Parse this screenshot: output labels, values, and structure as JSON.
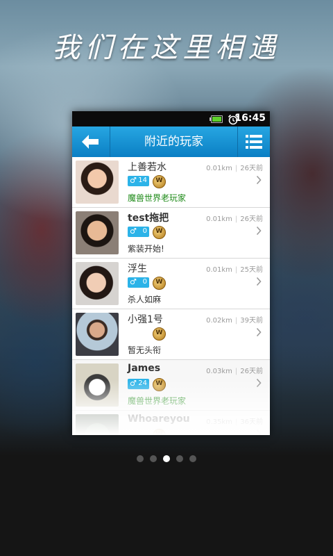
{
  "slogan": "我们在这里相遇",
  "status_bar": {
    "time": "16:45"
  },
  "header": {
    "title": "附近的玩家"
  },
  "players": [
    {
      "name": "上善若水",
      "age": "14",
      "distance": "0.01km",
      "time_ago": "26天前",
      "signature": "魔兽世界老玩家",
      "signature_color": "#1e8a18"
    },
    {
      "name": "test拖把",
      "age": "0",
      "distance": "0.01km",
      "time_ago": "26天前",
      "signature": "紫装开始!",
      "signature_color": "#333333"
    },
    {
      "name": "浮生",
      "age": "0",
      "distance": "0.01km",
      "time_ago": "25天前",
      "signature": "杀人如麻",
      "signature_color": "#333333"
    },
    {
      "name": "小强1号",
      "age": "",
      "distance": "0.02km",
      "time_ago": "39天前",
      "signature": "暂无头衔",
      "signature_color": "#333333"
    },
    {
      "name": "James",
      "age": "24",
      "distance": "0.03km",
      "time_ago": "26天前",
      "signature": "魔兽世界老玩家",
      "signature_color": "#1e8a18"
    },
    {
      "name": "Whoareyou",
      "age": "",
      "distance": "0.35km",
      "time_ago": "36天前",
      "signature": "",
      "signature_color": "#333333"
    }
  ],
  "pager": {
    "count": 5,
    "active_index": 2
  },
  "colors": {
    "accent": "#1a96d8",
    "gender_badge": "#2cb3e8"
  }
}
